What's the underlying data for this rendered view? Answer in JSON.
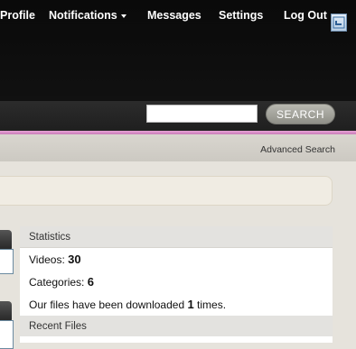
{
  "nav": {
    "profile": "Profile",
    "notifications": "Notifications",
    "messages": "Messages",
    "settings": "Settings",
    "logout": "Log Out"
  },
  "search": {
    "button": "SEARCH",
    "advanced": "Advanced Search",
    "value": ""
  },
  "statistics": {
    "title": "Statistics",
    "videos_label": "Videos:",
    "videos_value": "30",
    "categories_label": "Categories:",
    "categories_value": "6",
    "downloads_prefix": "Our files have been downloaded",
    "downloads_value": "1",
    "downloads_suffix": "times."
  },
  "recent": {
    "title": "Recent Files"
  },
  "colors": {
    "accent_pink": "#d68cc6",
    "nav_bg": "#0d0d0d"
  }
}
